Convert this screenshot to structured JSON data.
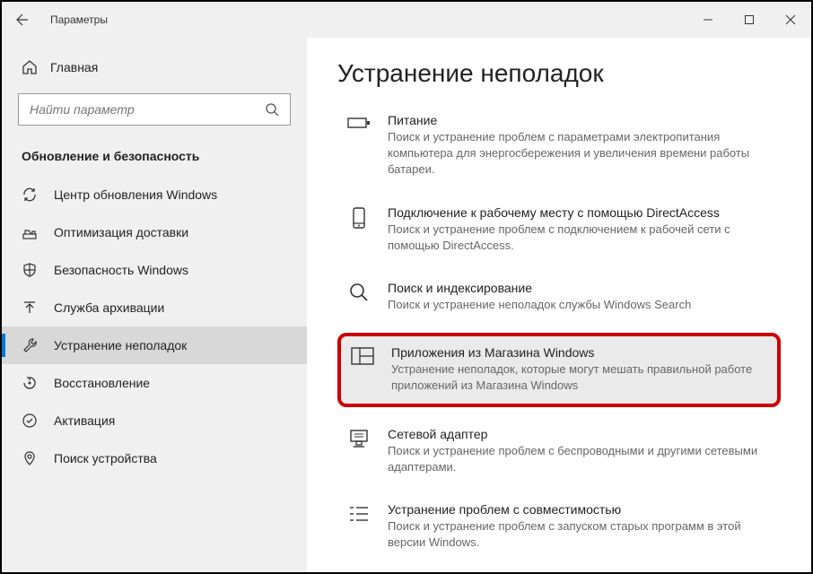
{
  "titlebar": {
    "title": "Параметры"
  },
  "sidebar": {
    "home": "Главная",
    "search_placeholder": "Найти параметр",
    "section": "Обновление и безопасность",
    "items": [
      {
        "label": "Центр обновления Windows"
      },
      {
        "label": "Оптимизация доставки"
      },
      {
        "label": "Безопасность Windows"
      },
      {
        "label": "Служба архивации"
      },
      {
        "label": "Устранение неполадок"
      },
      {
        "label": "Восстановление"
      },
      {
        "label": "Активация"
      },
      {
        "label": "Поиск устройства"
      }
    ]
  },
  "main": {
    "title": "Устранение неполадок",
    "items": [
      {
        "title": "Питание",
        "desc": "Поиск и устранение проблем с параметрами электропитания компьютера для энергосбережения и увеличения  времени работы батареи."
      },
      {
        "title": "Подключение к рабочему месту с помощью DirectAccess",
        "desc": "Поиск и устранение проблем с подключением к рабочей сети с помощью DirectAccess."
      },
      {
        "title": "Поиск и индексирование",
        "desc": "Поиск и устранение неполадок службы Windows Search"
      },
      {
        "title": "Приложения из Магазина Windows",
        "desc": "Устранение неполадок, которые могут мешать правильной работе приложений из Магазина Windows"
      },
      {
        "title": "Сетевой адаптер",
        "desc": "Поиск и устранение проблем с беспроводными и другими сетевыми адаптерами."
      },
      {
        "title": "Устранение проблем с совместимостью",
        "desc": "Поиск и устранение проблем с запуском старых программ в этой версии Windows."
      }
    ]
  }
}
